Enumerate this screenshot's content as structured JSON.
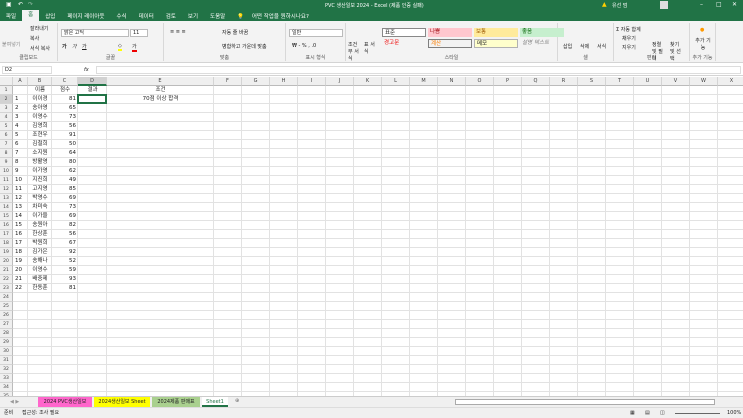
{
  "title_bar": {
    "doc_title": "PVC 생산일보 2024 - Excel (제품 인증 실패)",
    "user": "유선 덤",
    "warning_icon": "warning-icon"
  },
  "ribbon_tabs": [
    "파일",
    "홈",
    "삽입",
    "페이지 레이아웃",
    "수식",
    "데이터",
    "검토",
    "보기",
    "도움말"
  ],
  "active_tab": "홈",
  "tell_me": "어떤 작업을 원하시나요?",
  "clipboard": {
    "paste": "붙여넣기",
    "cut": "잘라내기",
    "copy": "복사",
    "format_painter": "서식 복사",
    "label": "클립보드"
  },
  "font": {
    "name": "맑은 고딕",
    "size": "11",
    "label": "글꼴"
  },
  "alignment": {
    "wrap": "자동 줄 바꿈",
    "merge": "병합하고 가운데 맞춤",
    "label": "맞춤"
  },
  "number": {
    "format": "일반",
    "label": "표시 형식"
  },
  "styles": {
    "cond_format": "조건부 서식",
    "table_format": "표 서식",
    "items": [
      "표준",
      "나쁨",
      "보통",
      "좋음",
      "경고문",
      "계산",
      "메모",
      "설명 텍스트"
    ],
    "label": "스타일"
  },
  "cells": {
    "insert": "삽입",
    "delete": "삭제",
    "format": "서식",
    "label": "셀"
  },
  "editing": {
    "autosum": "자동 합계",
    "fill": "채우기",
    "clear": "지우기",
    "sort": "정렬 및 필터",
    "find": "찾기 및 선택",
    "label": "편집"
  },
  "addins": {
    "button": "추가 기능",
    "label": "추가 기능"
  },
  "formula_bar": {
    "name_box": "D2",
    "fx": "fx",
    "value": ""
  },
  "columns": [
    "A",
    "B",
    "C",
    "D",
    "E",
    "F",
    "G",
    "H",
    "I",
    "J",
    "K",
    "L",
    "M",
    "N",
    "O",
    "P",
    "Q",
    "R",
    "S",
    "T",
    "U",
    "V",
    "W",
    "X"
  ],
  "header_row": {
    "B": "이름",
    "C": "점수",
    "D": "결과",
    "E": "조건"
  },
  "condition": "70점 이상 합격",
  "rows": [
    [
      "1",
      "이이경",
      "81"
    ],
    [
      "2",
      "송아영",
      "65"
    ],
    [
      "3",
      "이영수",
      "73"
    ],
    [
      "4",
      "김영희",
      "56"
    ],
    [
      "5",
      "조현우",
      "91"
    ],
    [
      "6",
      "김철희",
      "50"
    ],
    [
      "7",
      "소지원",
      "64"
    ],
    [
      "8",
      "방활영",
      "80"
    ],
    [
      "9",
      "이가영",
      "62"
    ],
    [
      "10",
      "지진희",
      "49"
    ],
    [
      "11",
      "고지영",
      "85"
    ],
    [
      "12",
      "박영수",
      "69"
    ],
    [
      "13",
      "차미숙",
      "73"
    ],
    [
      "14",
      "이가을",
      "69"
    ],
    [
      "15",
      "송원아",
      "82"
    ],
    [
      "16",
      "한상훈",
      "56"
    ],
    [
      "17",
      "박원희",
      "67"
    ],
    [
      "18",
      "김가은",
      "92"
    ],
    [
      "19",
      "송해나",
      "52"
    ],
    [
      "20",
      "이영수",
      "59"
    ],
    [
      "21",
      "배중제",
      "93"
    ],
    [
      "22",
      "한동훈",
      "81"
    ]
  ],
  "sheet_tabs": [
    {
      "name": "2024 PVC생산일보",
      "color": "#ff66cc"
    },
    {
      "name": "2024생산일보 Sheet",
      "color": "#ffff00"
    },
    {
      "name": "2024제품 판매표",
      "color": "#a9d08e"
    },
    {
      "name": "Sheet1",
      "color": "#ffffff"
    }
  ],
  "status": {
    "ready": "준비",
    "accessibility": "접근성: 조사 필요",
    "zoom": "100%"
  }
}
